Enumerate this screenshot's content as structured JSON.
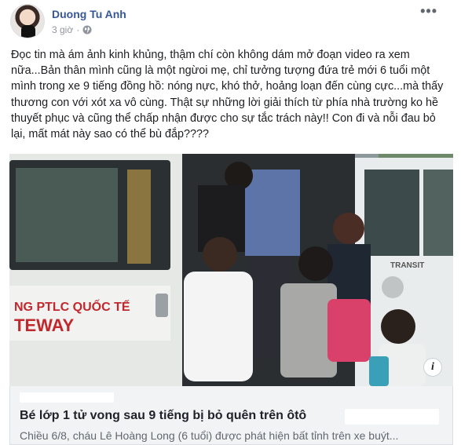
{
  "post": {
    "author": "Duong Tu Anh",
    "time": "3 giờ",
    "privacy_icon": "globe-icon",
    "more_icon": "more-options-icon",
    "text": "Đọc tin mà ám ảnh kinh khủng, thậm chí còn không dám mở đoạn video ra xem nữa...Bản thân mình cũng là một ngừoi mẹ, chỉ tưởng tượng đứa trẻ mới 6 tuổi một mình trong xe 9 tiếng đồng hồ: nóng nực, khó thở, hoảng loạn đến cùng cực...mà thấy thương con với xót xa vô cùng. Thật sự những lời giải thích từ phía nhà trường ko hề thuyết phục và cũng thể chấp nhận được cho sự tắc trách này!! Con đi và nỗi đau bỏ lại, mất mát này sao có thể bù đắp????"
  },
  "media": {
    "bus_text_line1": "NG PTLC QUỐC TẾ",
    "bus_text_line2": "TEWAY",
    "bus_brand": "TRANSIT",
    "info_icon": "info-icon",
    "info_label": "i"
  },
  "link_preview": {
    "title": "Bé lớp 1 tử vong sau 9 tiếng bị bỏ quên trên ôtô",
    "description": "Chiều 6/8, cháu Lê Hoàng Long (6 tuổi) được phát hiện bất tỉnh trên xe buýt..."
  },
  "colors": {
    "author": "#365899",
    "meta": "#90949c",
    "link_bg": "#f2f3f5",
    "bus_white": "#e9ecec",
    "bus_red": "#c0282d"
  }
}
